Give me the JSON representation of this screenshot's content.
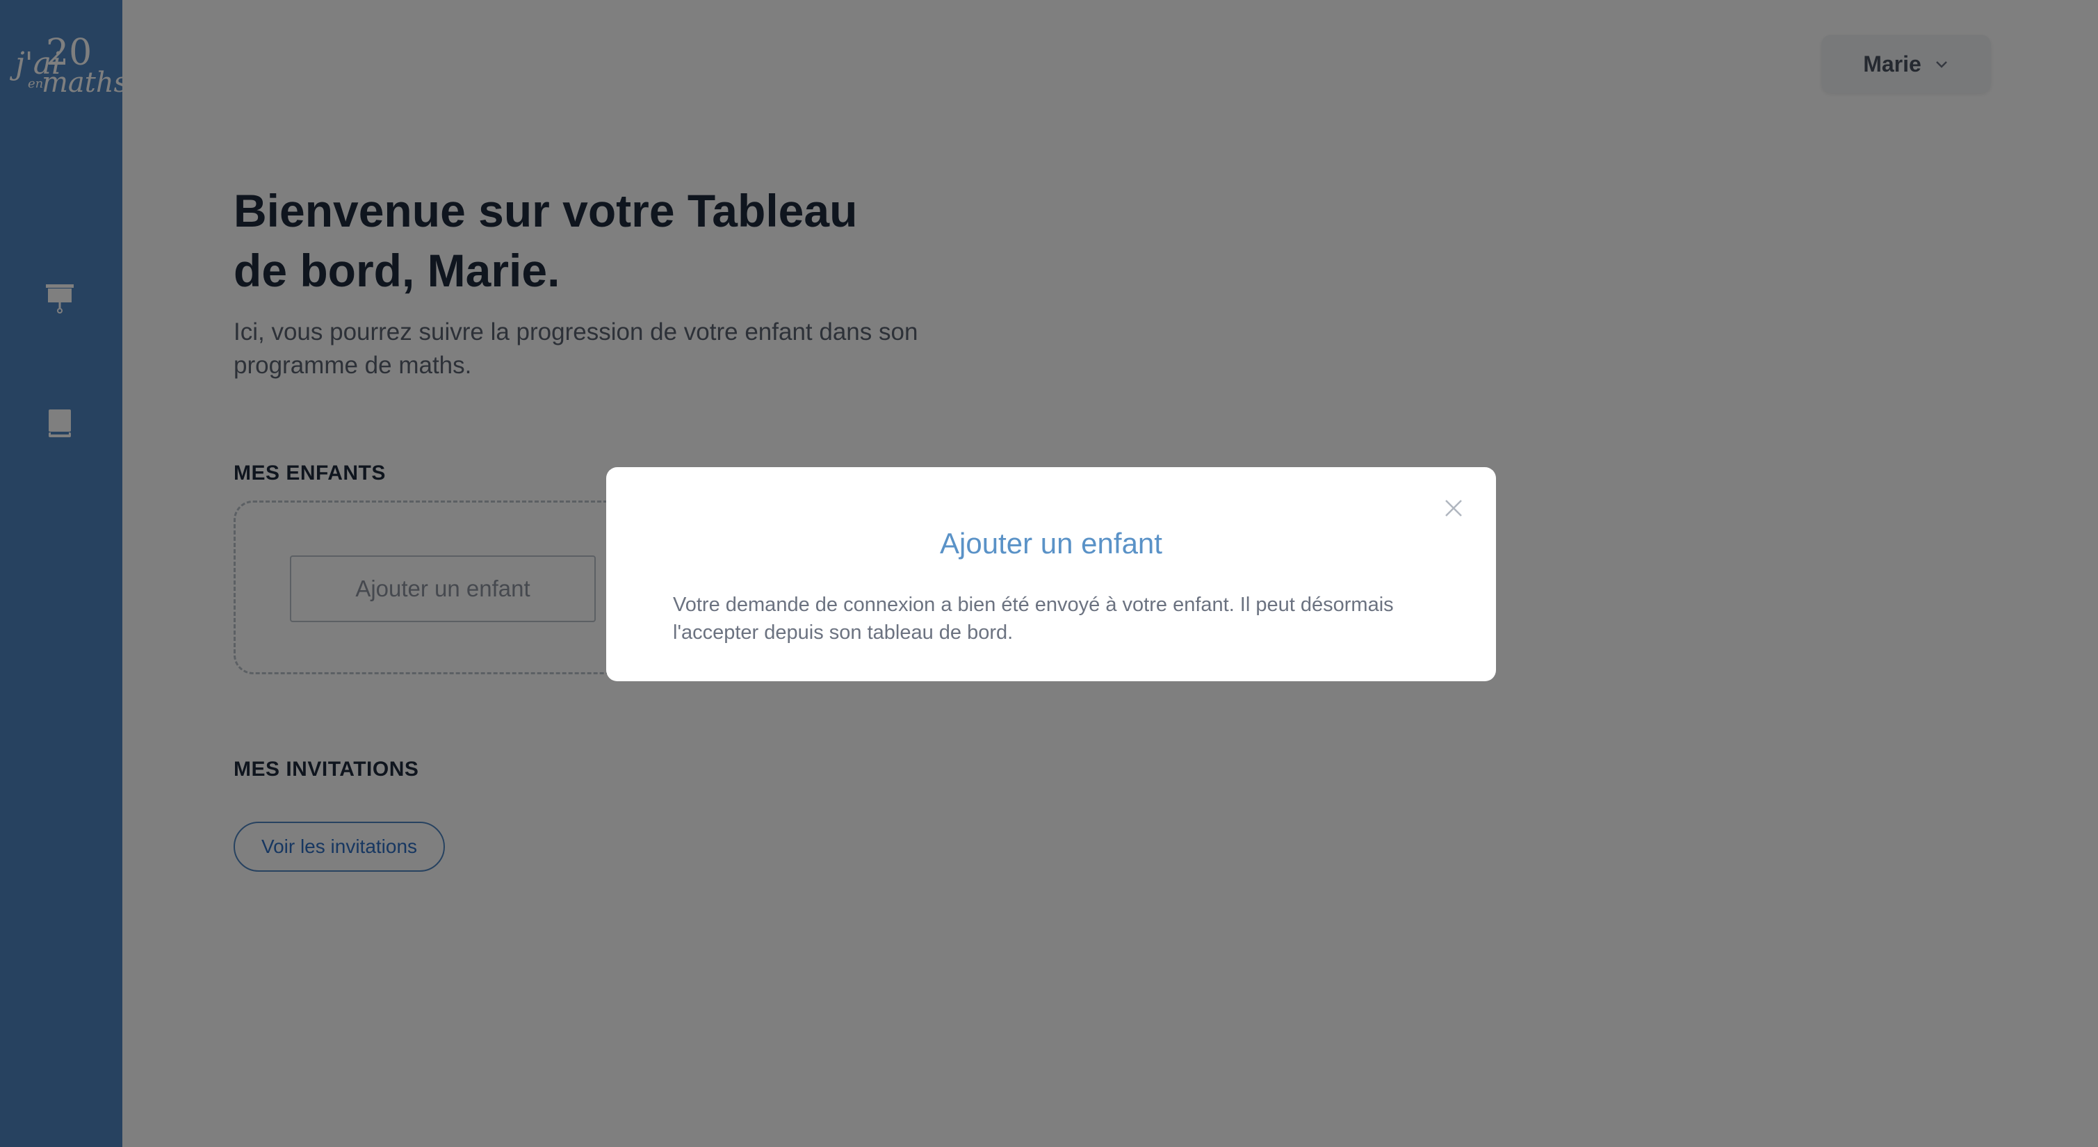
{
  "brand": {
    "logo_text_line1": "j'ai",
    "logo_text_number": "20",
    "logo_text_small": "en",
    "logo_text_line2": "maths",
    "sidebar_color": "#4f85c0"
  },
  "sidebar": {
    "items": [
      {
        "icon": "presentation-board-icon"
      },
      {
        "icon": "book-icon"
      }
    ]
  },
  "header": {
    "user_name": "Marie"
  },
  "main": {
    "title": "Bienvenue sur votre Tableau de bord, Marie.",
    "subtitle": "Ici, vous pourrez suivre la progression de votre enfant dans son programme de maths.",
    "children_section_title": "MES ENFANTS",
    "add_child_label": "Ajouter un enfant",
    "invitations_section_title": "MES INVITATIONS",
    "view_invitations_label": "Voir les invitations"
  },
  "modal": {
    "title": "Ajouter un enfant",
    "message": "Votre demande de connexion a bien été envoyé à votre enfant. Il peut désormais l'accepter depuis son tableau de bord."
  }
}
